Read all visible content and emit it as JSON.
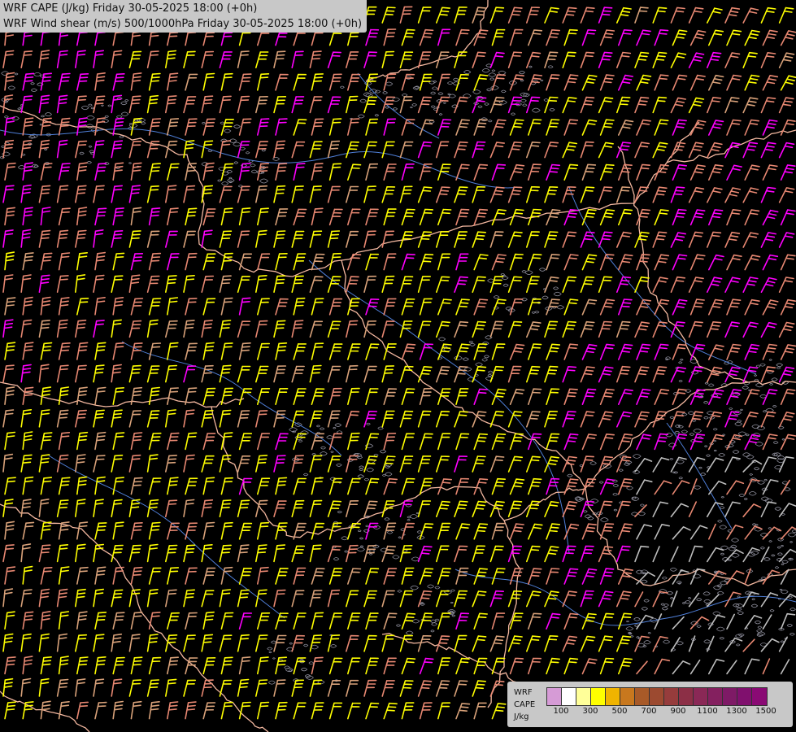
{
  "map": {
    "titles": [
      "WRF CAPE (J/kg) Friday 30-05-2025 18:00 (+0h)",
      "WRF Wind shear (m/s) 500/1000hPa Friday 30-05-2025 18:00 (+0h)"
    ],
    "layers": [
      "cape-shading",
      "wind-shear-barbs",
      "country-borders",
      "rivers",
      "terrain-contours"
    ],
    "colors": {
      "background": "#000000",
      "borders": "#f4b8a0",
      "rivers": "#4f7fd8",
      "contours": "#b7b7c8",
      "barb_low": "#bebebe",
      "barb_mid": "#e88872",
      "barb_yellow": "#ffff00",
      "barb_tan": "#d9a27a",
      "barb_magenta": "#ff00ff"
    }
  },
  "legend": {
    "lines": [
      "WRF",
      "CAPE",
      "J/kg"
    ],
    "tick_labels": [
      "100",
      "300",
      "500",
      "700",
      "900",
      "1100",
      "1300",
      "1500"
    ],
    "swatches": [
      "#d69bd6",
      "#ffffff",
      "#ffff99",
      "#ffff00",
      "#f0b400",
      "#c8781e",
      "#a85a28",
      "#9c4a30",
      "#963c3c",
      "#8c2f46",
      "#8a2856",
      "#84205f",
      "#7e1a66",
      "#80106e",
      "#8a0a74"
    ]
  }
}
